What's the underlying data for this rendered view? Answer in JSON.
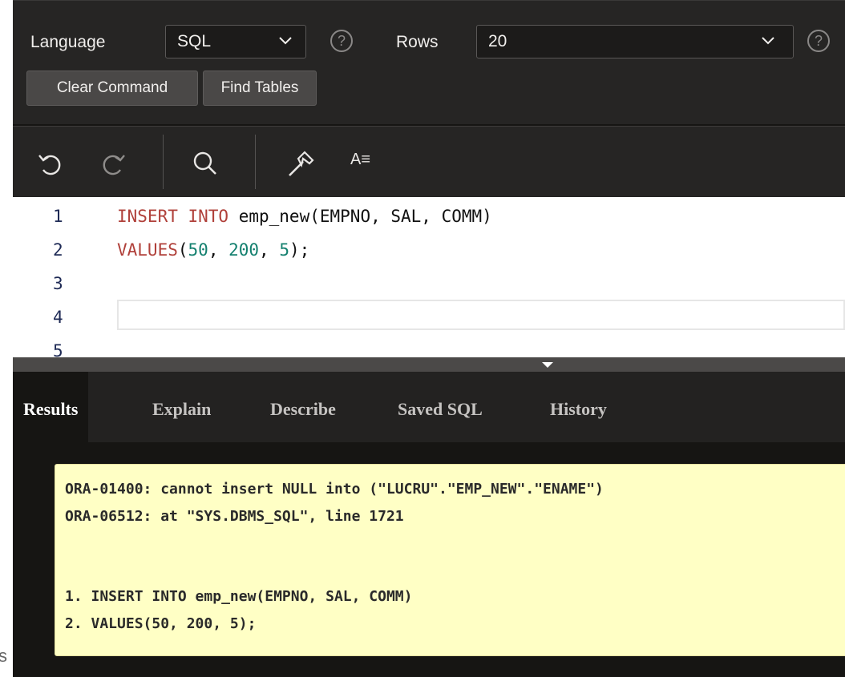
{
  "toolbar": {
    "language_label": "Language",
    "language_value": "SQL",
    "rows_label": "Rows",
    "rows_value": "20",
    "help_glyph": "?",
    "clear_command": "Clear Command",
    "find_tables": "Find Tables"
  },
  "editor_toolbar": {
    "icons": [
      "undo-icon",
      "redo-icon",
      "search-icon",
      "hammer-icon",
      "text-format-icon"
    ],
    "format_label": "A≡"
  },
  "editor": {
    "line_numbers": [
      "1",
      "2",
      "3",
      "4",
      "5"
    ],
    "lines": [
      {
        "kw": "INSERT INTO",
        "rest": " emp_new(EMPNO, SAL, COMM)"
      },
      {
        "kw": "VALUES",
        "rest_parts": [
          "(",
          "50",
          ", ",
          "200",
          ", ",
          "5",
          ");"
        ]
      },
      {
        "text": ""
      },
      {
        "text": ""
      },
      {
        "text": ""
      }
    ],
    "line2_kw": "VALUES",
    "line2_open": "(",
    "line2_n1": "50",
    "line2_sep1": ", ",
    "line2_n2": "200",
    "line2_sep2": ", ",
    "line2_n3": "5",
    "line2_close": ");"
  },
  "tabs": [
    {
      "label": "Results",
      "active": true
    },
    {
      "label": "Explain",
      "active": false
    },
    {
      "label": "Describe",
      "active": false
    },
    {
      "label": "Saved SQL",
      "active": false
    },
    {
      "label": "History",
      "active": false
    }
  ],
  "results": {
    "error_lines": [
      "ORA-01400: cannot insert NULL into (\"LUCRU\".\"EMP_NEW\".\"ENAME\")",
      "ORA-06512: at \"SYS.DBMS_SQL\", line 1721",
      "1. INSERT INTO emp_new(EMPNO, SAL, COMM)",
      "2. VALUES(50, 200, 5);"
    ]
  },
  "left_edge_text": "s",
  "colors": {
    "background": "#161513",
    "toolbar": "#262524",
    "keyword": "#b0403a",
    "number": "#14806f",
    "error_bg": "#ffffc5"
  }
}
